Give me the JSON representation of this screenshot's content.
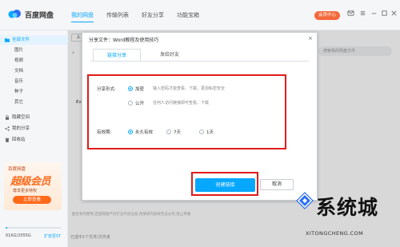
{
  "app": {
    "name": "百度网盘"
  },
  "nav": {
    "tabs": [
      {
        "label": "我的网盘"
      },
      {
        "label": "传输列表"
      },
      {
        "label": "好友分享"
      },
      {
        "label": "功能宝箱"
      }
    ],
    "vip_button": "会员中心"
  },
  "sidebar": {
    "items": [
      {
        "label": "全部文件",
        "icon": "folder-icon"
      },
      {
        "label": "图片"
      },
      {
        "label": "视频"
      },
      {
        "label": "文档"
      },
      {
        "label": "音乐"
      },
      {
        "label": "种子"
      },
      {
        "label": "其它"
      },
      {
        "label": "隐藏空间",
        "icon": "lock-icon"
      },
      {
        "label": "我的分享",
        "icon": "share-icon"
      },
      {
        "label": "回收站",
        "icon": "trash-icon"
      }
    ],
    "promo": {
      "top": "百度网盘",
      "headline": "超级会员",
      "subtitle": "尊享更多特权",
      "button": "立即查看"
    },
    "storage": {
      "text": "61KG/2055G",
      "fraction": 0.03,
      "expand": "扩容至5T"
    }
  },
  "main": {
    "upload": "上",
    "search_placeholder": "搜索我的网盘文件",
    "file_fragment": "Exc",
    "status": "已选中1个文件/文件夹",
    "hint": "配合系列使用,百度网盘严厉打击不良信息,色情等内容将无法分享,禁止传播"
  },
  "dialog": {
    "title": "分享文件：Word教程及使用技巧",
    "tabs": [
      {
        "label": "链接分享"
      },
      {
        "label": "发给好友"
      }
    ],
    "share_form_label": "分享形式:",
    "share_options": [
      {
        "label": "加密",
        "desc": "输入密码才能查看、下载，更加私密安全",
        "checked": true
      },
      {
        "label": "公开",
        "desc": "任何人访问链接即可查看、下载",
        "checked": false
      }
    ],
    "validity_label": "有效期:",
    "validity_options": [
      {
        "label": "永久有效",
        "checked": true
      },
      {
        "label": "7天",
        "checked": false
      },
      {
        "label": "1天",
        "checked": false
      }
    ],
    "create_button": "创建链接",
    "cancel_button": "取消"
  },
  "watermark": {
    "text": "系统城",
    "sub": "XITONGCHENG.COM"
  },
  "colors": {
    "accent": "#06a7ff",
    "highlight": "#e11b1b",
    "vip": "#f36a3b"
  }
}
